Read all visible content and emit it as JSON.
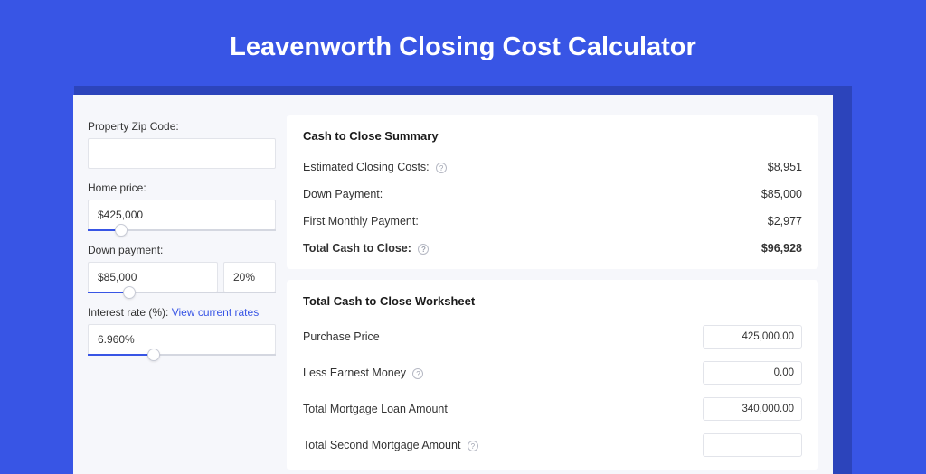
{
  "title": "Leavenworth Closing Cost Calculator",
  "sidebar": {
    "zip_label": "Property Zip Code:",
    "zip_value": "",
    "home_price_label": "Home price:",
    "home_price_value": "$425,000",
    "home_price_slider_pct": 18,
    "down_payment_label": "Down payment:",
    "down_payment_value": "$85,000",
    "down_payment_pct_value": "20%",
    "down_payment_slider_pct": 22,
    "interest_rate_label": "Interest rate (%): ",
    "interest_rate_link": "View current rates",
    "interest_rate_value": "6.960%",
    "interest_rate_slider_pct": 35
  },
  "summary": {
    "heading": "Cash to Close Summary",
    "rows": [
      {
        "label": "Estimated Closing Costs:",
        "help": true,
        "value": "$8,951"
      },
      {
        "label": "Down Payment:",
        "help": false,
        "value": "$85,000"
      },
      {
        "label": "First Monthly Payment:",
        "help": false,
        "value": "$2,977"
      }
    ],
    "total": {
      "label": "Total Cash to Close:",
      "help": true,
      "value": "$96,928"
    }
  },
  "worksheet": {
    "heading": "Total Cash to Close Worksheet",
    "rows": [
      {
        "label": "Purchase Price",
        "help": false,
        "value": "425,000.00"
      },
      {
        "label": "Less Earnest Money",
        "help": true,
        "value": "0.00"
      },
      {
        "label": "Total Mortgage Loan Amount",
        "help": false,
        "value": "340,000.00"
      },
      {
        "label": "Total Second Mortgage Amount",
        "help": true,
        "value": ""
      }
    ]
  }
}
